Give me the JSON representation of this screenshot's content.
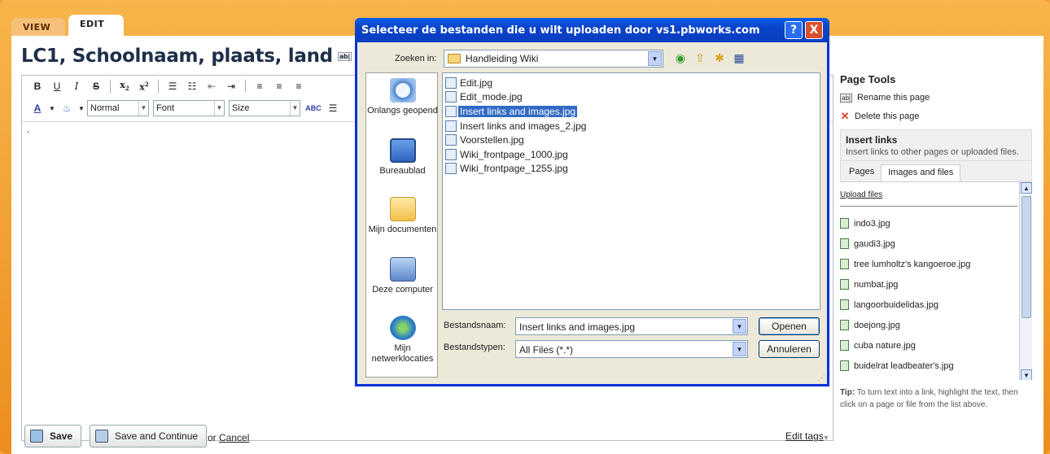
{
  "tabs": {
    "view": "VIEW",
    "edit": "EDIT"
  },
  "page": {
    "title": "LC1, Schoolnaam, plaats, land",
    "rename_badge": "ab|"
  },
  "toolbar": {
    "format_select": "Normal",
    "font_select": "Font",
    "size_select": "Size"
  },
  "editor": {
    "content": "."
  },
  "actions": {
    "save": "Save",
    "save_continue": "Save and Continue",
    "or": "or",
    "cancel": "Cancel",
    "edit_tags": "Edit tags"
  },
  "sidebar": {
    "page_tools_title": "Page Tools",
    "rename_label": "Rename this page",
    "delete_label": "Delete this page",
    "insert_title": "Insert links",
    "insert_subtitle": "Insert links to other pages or uploaded files.",
    "tabs": [
      "Pages",
      "Images and files"
    ],
    "upload_label": "Upload files",
    "files": [
      "indo3.jpg",
      "gaudi3.jpg",
      "tree lumholtz's kangoeroe.jpg",
      "numbat.jpg",
      "langoorbuidelidas.jpg",
      "doejong.jpg",
      "cuba nature.jpg",
      "buidelrat leadbeater's.jpg"
    ],
    "tip_label": "Tip:",
    "tip_text": "To turn text into a link, highlight the text, then click on a page or file from the list above."
  },
  "dialog": {
    "title": "Selecteer de bestanden die u wilt uploaden door vs1.pbworks.com",
    "help_button": "?",
    "close_button": "X",
    "look_in_label": "Zoeken in:",
    "look_in_value": "Handleiding Wiki",
    "places": [
      "Onlangs geopend",
      "Bureaublad",
      "Mijn documenten",
      "Deze computer",
      "Mijn netwerklocaties"
    ],
    "files": [
      "Edit.jpg",
      "Edit_mode.jpg",
      "Insert links and images.jpg",
      "Insert links and images_2.jpg",
      "Voorstellen.jpg",
      "Wiki_frontpage_1000.jpg",
      "Wiki_frontpage_1255.jpg"
    ],
    "selected_file": "Insert links and images.jpg",
    "filename_label": "Bestandsnaam:",
    "filename_value": "Insert links and images.jpg",
    "filetype_label": "Bestandstypen:",
    "filetype_value": "All Files (*.*)",
    "open_button": "Openen",
    "cancel_button": "Annuleren"
  },
  "colors": {
    "frame_orange": "#ec8d1f",
    "dialog_titlebar": "#0b43c8",
    "selection": "#316ac5"
  }
}
